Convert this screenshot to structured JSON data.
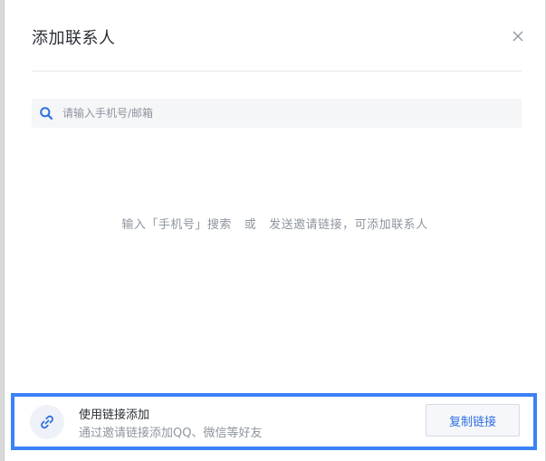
{
  "dialog": {
    "title": "添加联系人",
    "close_icon": "close-icon"
  },
  "search": {
    "placeholder": "请输入手机号/邮箱",
    "value": "",
    "icon": "search-icon"
  },
  "empty_state": {
    "hint": "输入「手机号」搜索   或   发送邀请链接，可添加联系人"
  },
  "invite": {
    "icon": "link-icon",
    "title": "使用链接添加",
    "subtitle": "通过邀请链接添加QQ、微信等好友",
    "copy_button": "复制链接"
  },
  "colors": {
    "accent": "#2f6fe0",
    "highlight_border": "#3b82f6",
    "muted_text": "#8f959e",
    "primary_text": "#2b2f36"
  }
}
